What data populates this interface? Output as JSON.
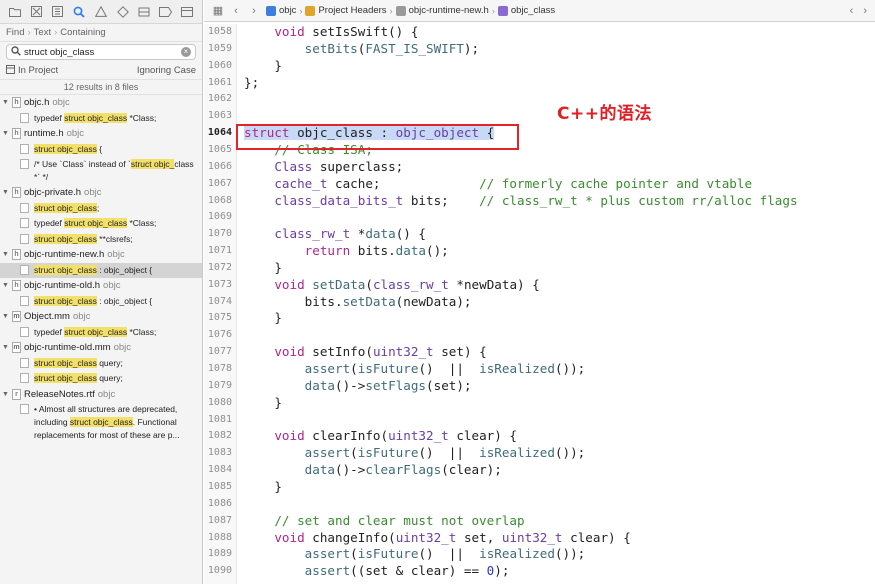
{
  "navigator": {
    "toolbar_icons": [
      "folder-icon",
      "source-control-icon",
      "symbol-icon",
      "search-icon",
      "issue-icon",
      "test-icon",
      "debug-icon",
      "breakpoint-icon",
      "report-icon"
    ],
    "find_bar": {
      "mode": "Find",
      "type": "Text",
      "match": "Containing"
    },
    "search": {
      "value": "struct objc_class"
    },
    "scope": {
      "label": "In Project",
      "case": "Ignoring Case"
    },
    "results_count": "12 results in 8 files",
    "files": [
      {
        "name": "objc.h",
        "folder": "objc",
        "icon": "h",
        "matches": [
          {
            "pre": "typedef ",
            "hit": "struct objc_class",
            "post": " *Class;"
          }
        ]
      },
      {
        "name": "runtime.h",
        "folder": "objc",
        "icon": "h",
        "matches": [
          {
            "pre": "",
            "hit": "struct objc_class",
            "post": " {"
          },
          {
            "pre": "/* Use `Class` instead of `",
            "hit": "struct objc_",
            "post": "class *` */"
          }
        ]
      },
      {
        "name": "objc-private.h",
        "folder": "objc",
        "icon": "h",
        "matches": [
          {
            "pre": "",
            "hit": "struct objc_class",
            "post": ";"
          },
          {
            "pre": "typedef ",
            "hit": "struct objc_class",
            "post": " *Class;"
          },
          {
            "pre": "",
            "hit": "struct objc_class",
            "post": " **clsrefs;"
          }
        ]
      },
      {
        "name": "objc-runtime-new.h",
        "folder": "objc",
        "icon": "h",
        "matches": [
          {
            "pre": "",
            "hit": "struct objc_class",
            "post": " : objc_object {",
            "selected": true
          }
        ]
      },
      {
        "name": "objc-runtime-old.h",
        "folder": "objc",
        "icon": "h",
        "matches": [
          {
            "pre": "",
            "hit": "struct objc_class",
            "post": " : objc_object {"
          }
        ]
      },
      {
        "name": "Object.mm",
        "folder": "objc",
        "icon": "m",
        "matches": [
          {
            "pre": "typedef ",
            "hit": "struct objc_class",
            "post": " *Class;"
          }
        ]
      },
      {
        "name": "objc-runtime-old.mm",
        "folder": "objc",
        "icon": "m",
        "matches": [
          {
            "pre": "",
            "hit": "struct objc_class",
            "post": " query;"
          },
          {
            "pre": "",
            "hit": "struct objc_class",
            "post": " query;"
          }
        ]
      },
      {
        "name": "ReleaseNotes.rtf",
        "folder": "objc",
        "icon": "r",
        "matches": [
          {
            "pre": "• Almost all structures are deprecated, including ",
            "hit": "struct objc_class",
            "post": ". Functional replacements for most of these are p..."
          }
        ]
      }
    ]
  },
  "jumpbar": {
    "crumbs": [
      {
        "label": "objc",
        "color": "#3d7fe0"
      },
      {
        "label": "Project Headers",
        "color": "#e0a52c"
      },
      {
        "label": "objc-runtime-new.h",
        "color": "#9a9a9a"
      },
      {
        "label": "objc_class",
        "color": "#8a6ad1"
      }
    ]
  },
  "editor": {
    "current_line": 1064,
    "lines": [
      {
        "n": 1058,
        "code": "    void setIsSwift() {"
      },
      {
        "n": 1059,
        "code": "        setBits(FAST_IS_SWIFT);"
      },
      {
        "n": 1060,
        "code": "    }"
      },
      {
        "n": 1061,
        "code": "};"
      },
      {
        "n": 1062,
        "code": ""
      },
      {
        "n": 1063,
        "code": ""
      },
      {
        "n": 1064,
        "code": "struct objc_class : objc_object {"
      },
      {
        "n": 1065,
        "code": "    // Class ISA;"
      },
      {
        "n": 1066,
        "code": "    Class superclass;"
      },
      {
        "n": 1067,
        "code": "    cache_t cache;             // formerly cache pointer and vtable"
      },
      {
        "n": 1068,
        "code": "    class_data_bits_t bits;    // class_rw_t * plus custom rr/alloc flags"
      },
      {
        "n": 1069,
        "code": ""
      },
      {
        "n": 1070,
        "code": "    class_rw_t *data() {"
      },
      {
        "n": 1071,
        "code": "        return bits.data();"
      },
      {
        "n": 1072,
        "code": "    }"
      },
      {
        "n": 1073,
        "code": "    void setData(class_rw_t *newData) {"
      },
      {
        "n": 1074,
        "code": "        bits.setData(newData);"
      },
      {
        "n": 1075,
        "code": "    }"
      },
      {
        "n": 1076,
        "code": ""
      },
      {
        "n": 1077,
        "code": "    void setInfo(uint32_t set) {"
      },
      {
        "n": 1078,
        "code": "        assert(isFuture()  ||  isRealized());"
      },
      {
        "n": 1079,
        "code": "        data()->setFlags(set);"
      },
      {
        "n": 1080,
        "code": "    }"
      },
      {
        "n": 1081,
        "code": ""
      },
      {
        "n": 1082,
        "code": "    void clearInfo(uint32_t clear) {"
      },
      {
        "n": 1083,
        "code": "        assert(isFuture()  ||  isRealized());"
      },
      {
        "n": 1084,
        "code": "        data()->clearFlags(clear);"
      },
      {
        "n": 1085,
        "code": "    }"
      },
      {
        "n": 1086,
        "code": ""
      },
      {
        "n": 1087,
        "code": "    // set and clear must not overlap"
      },
      {
        "n": 1088,
        "code": "    void changeInfo(uint32_t set, uint32_t clear) {"
      },
      {
        "n": 1089,
        "code": "        assert(isFuture()  ||  isRealized());"
      },
      {
        "n": 1090,
        "code": "        assert((set & clear) == 0);"
      }
    ]
  },
  "annotation": {
    "text": "C++的语法"
  },
  "colors": {
    "annotation": "#e01f26",
    "match_highlight": "#f2e06a",
    "selection": "#c7d9f5"
  }
}
